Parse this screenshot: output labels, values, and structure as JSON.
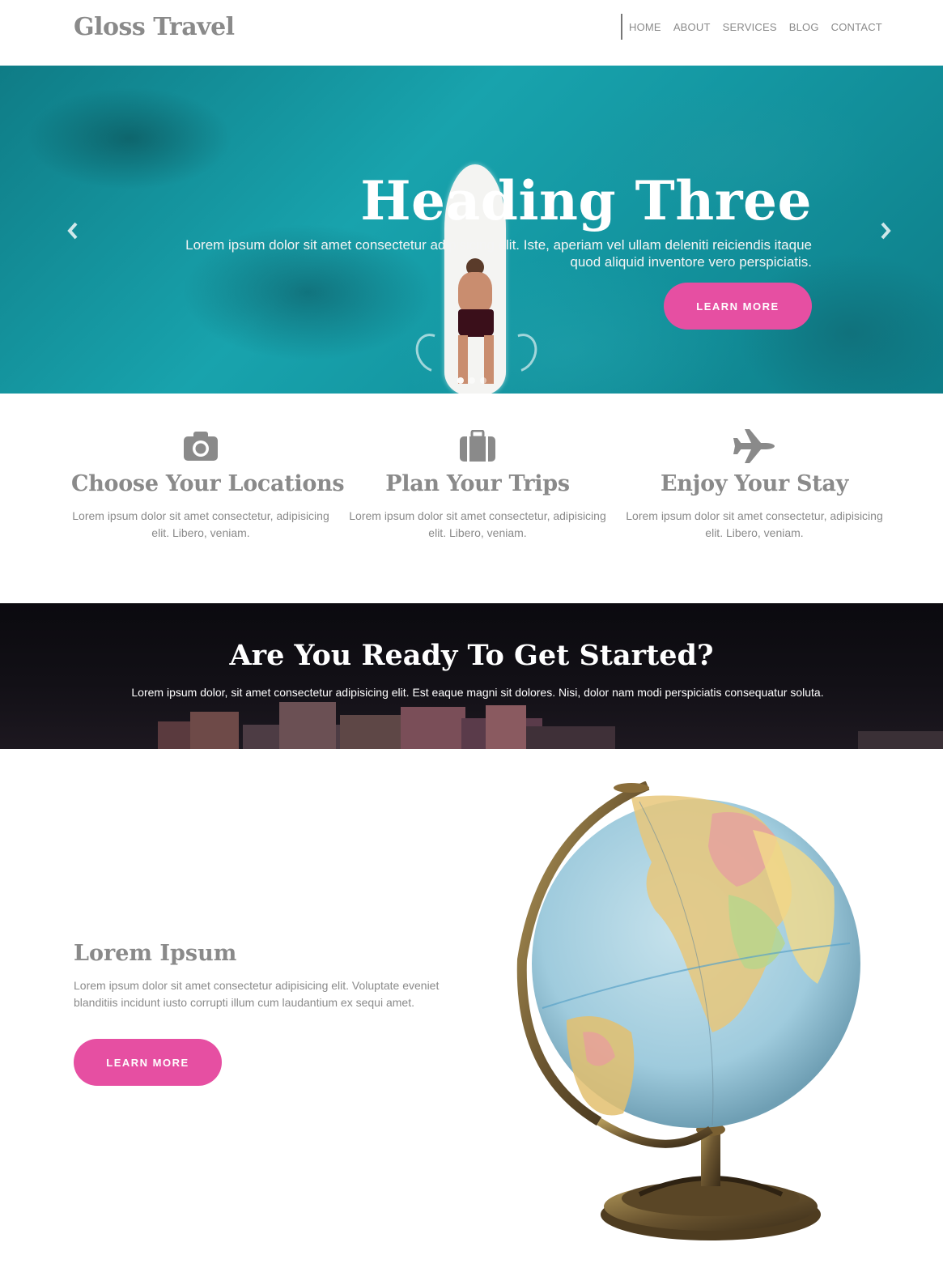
{
  "header": {
    "brand": "Gloss Travel",
    "nav": [
      "HOME",
      "ABOUT",
      "SERVICES",
      "BLOG",
      "CONTACT"
    ]
  },
  "hero": {
    "title": "Heading Three",
    "text": "Lorem ipsum dolor sit amet consectetur adipisicing elit. Iste, aperiam vel ullam deleniti reiciendis itaque quod aliquid inventore vero perspiciatis.",
    "button": "LEARN MORE",
    "prev_icon": "chevron-left-icon",
    "next_icon": "chevron-right-icon",
    "slide_count": 3,
    "active_slide": 1
  },
  "features": [
    {
      "icon": "camera-icon",
      "title": "Choose Your Locations",
      "text": "Lorem ipsum dolor sit amet consectetur, adipisicing elit. Libero, veniam."
    },
    {
      "icon": "suitcase-icon",
      "title": "Plan Your Trips",
      "text": "Lorem ipsum dolor sit amet consectetur, adipisicing elit. Libero, veniam."
    },
    {
      "icon": "plane-icon",
      "title": "Enjoy Your Stay",
      "text": "Lorem ipsum dolor sit amet consectetur, adipisicing elit. Libero, veniam."
    }
  ],
  "cta": {
    "title": "Are You Ready To Get Started?",
    "text": "Lorem ipsum dolor, sit amet consectetur adipisicing elit. Est eaque magni sit dolores. Nisi, dolor nam modi perspiciatis consequatur soluta."
  },
  "about": {
    "title": "Lorem Ipsum",
    "text": "Lorem ipsum dolor sit amet consectetur adipisicing elit. Voluptate eveniet blanditiis incidunt iusto corrupti illum cum laudantium ex sequi amet.",
    "button": "LEARN MORE",
    "image": "globe-image"
  },
  "colors": {
    "accent": "#e64fa2",
    "text_gray": "#8a8a8a",
    "hero_teal": "#18a3ad"
  }
}
